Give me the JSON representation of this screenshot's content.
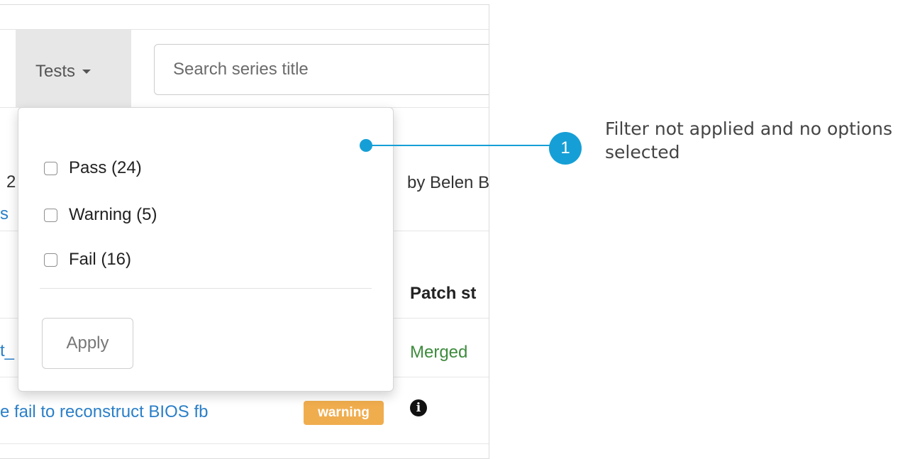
{
  "nav": {
    "tests_label": "Tests",
    "search_placeholder": "Search series title"
  },
  "background": {
    "fragment_2": "2",
    "fragment_s": "s",
    "fragment_t": "t_",
    "submitter_fragment": "by Belen B",
    "patch_status_header": "Patch st",
    "patch_status_value": "Merged",
    "series_title": "e fail to reconstruct BIOS fb",
    "test_badge": "warning",
    "info_icon": "info-circle-icon"
  },
  "dropdown": {
    "options": [
      {
        "label": "Pass (24)",
        "checked": false
      },
      {
        "label": "Warning (5)",
        "checked": false
      },
      {
        "label": "Fail (16)",
        "checked": false
      }
    ],
    "apply_label": "Apply"
  },
  "callout": {
    "number": "1",
    "text": "Filter not applied and no options selected"
  },
  "colors": {
    "accent": "#169fd6",
    "link": "#2a7fc8",
    "merged": "#3d8b3d",
    "warning": "#f0ad4e"
  }
}
